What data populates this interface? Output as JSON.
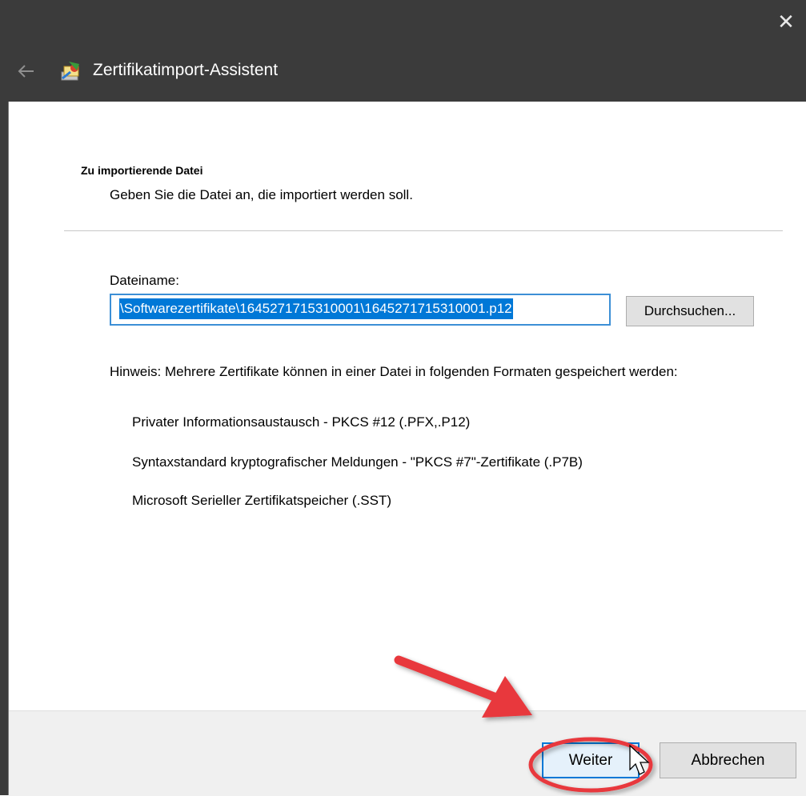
{
  "window": {
    "title": "Zertifikatimport-Assistent",
    "close_icon": "close-icon",
    "back_icon": "back-arrow-icon",
    "app_icon": "certificate-wizard-icon"
  },
  "page": {
    "title": "Zu importierende Datei",
    "subtitle": "Geben Sie die Datei an, die importiert werden soll."
  },
  "file": {
    "label": "Dateiname:",
    "value": "\\Softwarezertifikate\\1645271715310001\\1645271715310001.p12",
    "browse_label": "Durchsuchen..."
  },
  "hint": {
    "text": "Hinweis: Mehrere Zertifikate können in einer Datei in folgenden Formaten gespeichert werden:",
    "formats": [
      "Privater Informationsaustausch - PKCS #12 (.PFX,.P12)",
      "Syntaxstandard kryptografischer Meldungen - \"PKCS #7\"-Zertifikate (.P7B)",
      "Microsoft Serieller Zertifikatspeicher (.SST)"
    ]
  },
  "footer": {
    "next_label": "Weiter",
    "cancel_label": "Abbrechen"
  },
  "annotation": {
    "color": "#e8383d",
    "items": [
      "arrow-annotation",
      "highlight-circle"
    ]
  },
  "colors": {
    "titlebar": "#3b3b3b",
    "selection": "#0078d7",
    "footer": "#f0f0f0"
  }
}
